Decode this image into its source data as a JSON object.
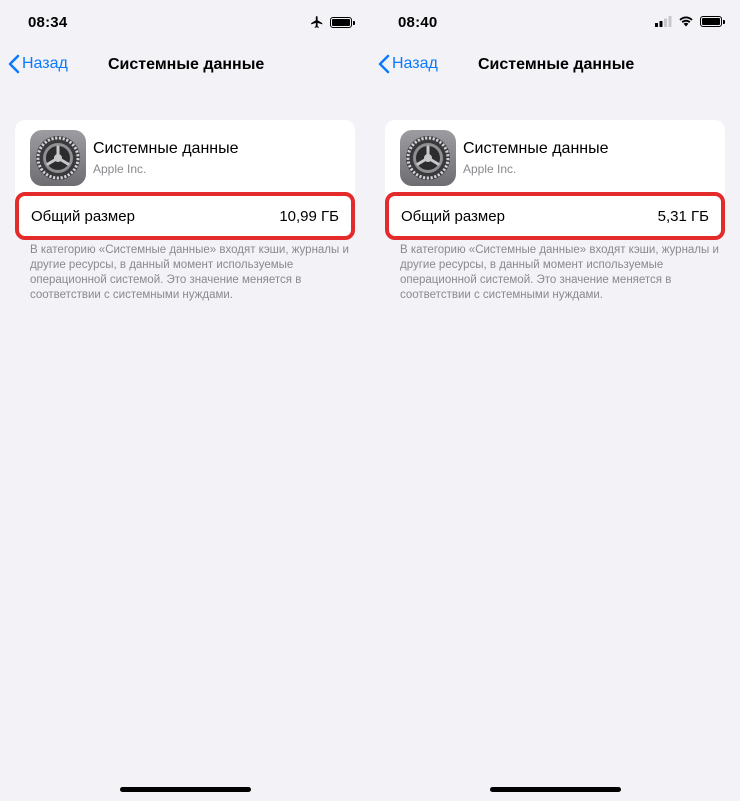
{
  "screens": [
    {
      "status": {
        "time": "08:34",
        "icons": [
          "airplane-icon",
          "battery-icon"
        ]
      },
      "nav": {
        "back": "Назад",
        "title": "Системные данные"
      },
      "app": {
        "name": "Системные данные",
        "vendor": "Apple Inc."
      },
      "size": {
        "label": "Общий размер",
        "value": "10,99 ГБ"
      },
      "footnote": "В категорию «Системные данные» входят кэши, журналы и другие ресурсы, в данный момент используемые операционной системой. Это значение меняется в соответствии с системными нуждами."
    },
    {
      "status": {
        "time": "08:40",
        "icons": [
          "cellular-icon",
          "wifi-icon",
          "battery-icon"
        ]
      },
      "nav": {
        "back": "Назад",
        "title": "Системные данные"
      },
      "app": {
        "name": "Системные данные",
        "vendor": "Apple Inc."
      },
      "size": {
        "label": "Общий размер",
        "value": "5,31 ГБ"
      },
      "footnote": "В категорию «Системные данные» входят кэши, журналы и другие ресурсы, в данный момент используемые операционной системой. Это значение меняется в соответствии с системными нуждами."
    }
  ],
  "colors": {
    "accent": "#0a7aff",
    "highlight": "#e32b2b",
    "background": "#f2f2f7",
    "secondary_text": "#8a8a8e"
  }
}
